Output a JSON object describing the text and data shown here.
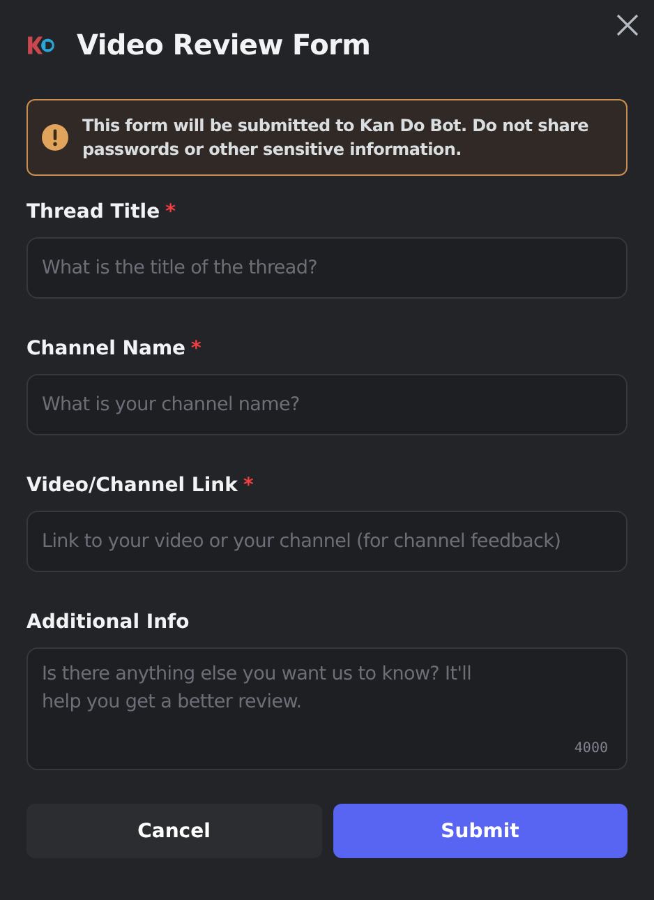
{
  "window": {
    "title": "Video Review Form"
  },
  "notice": {
    "text": "This form will be submitted to Kan Do Bot. Do not share passwords or other sensitive information."
  },
  "fields": [
    {
      "kind": "input",
      "label": "Thread Title",
      "required_mark": "*",
      "placeholder": "What is the title of the thread?"
    },
    {
      "kind": "input",
      "label": "Channel Name",
      "required_mark": "*",
      "placeholder": "What is your channel name?"
    },
    {
      "kind": "input",
      "label": "Video/Channel Link",
      "required_mark": "*",
      "placeholder": "Link to your video or your channel (for channel feedback)"
    },
    {
      "kind": "textarea",
      "label": "Additional Info",
      "placeholder": "Is there anything else you want us to know? It'll help you get a better review.",
      "counter": "4000"
    }
  ],
  "buttons": [
    {
      "label": "Cancel",
      "kind": "secondary"
    },
    {
      "label": "Submit",
      "kind": "primary"
    }
  ]
}
